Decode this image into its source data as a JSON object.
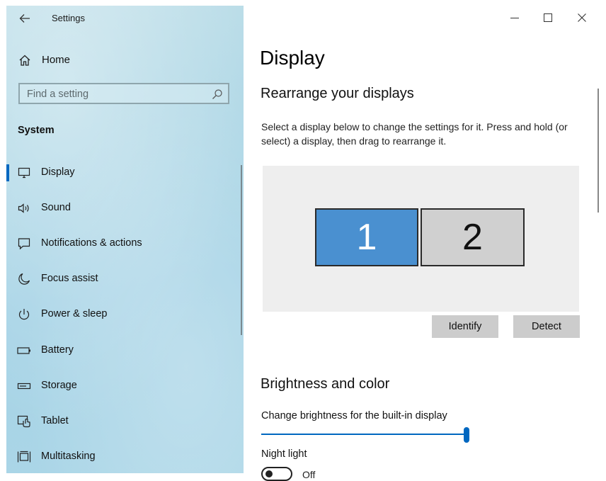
{
  "window": {
    "title": "Settings",
    "captions": {
      "minimize": "minimize-icon",
      "maximize": "maximize-icon",
      "close": "close-icon"
    }
  },
  "sidebar": {
    "home_label": "Home",
    "search_placeholder": "Find a setting",
    "section_title": "System",
    "items": [
      {
        "label": "Display",
        "icon": "monitor-icon",
        "selected": true
      },
      {
        "label": "Sound",
        "icon": "speaker-icon"
      },
      {
        "label": "Notifications & actions",
        "icon": "notification-icon"
      },
      {
        "label": "Focus assist",
        "icon": "moon-icon"
      },
      {
        "label": "Power & sleep",
        "icon": "power-icon"
      },
      {
        "label": "Battery",
        "icon": "battery-icon"
      },
      {
        "label": "Storage",
        "icon": "storage-icon"
      },
      {
        "label": "Tablet",
        "icon": "tablet-icon"
      },
      {
        "label": "Multitasking",
        "icon": "multitasking-icon"
      }
    ]
  },
  "main": {
    "title": "Display",
    "rearrange": {
      "heading": "Rearrange your displays",
      "description": "Select a display below to change the settings for it. Press and hold (or select) a display, then drag to rearrange it.",
      "monitors": [
        {
          "label": "1",
          "selected": true
        },
        {
          "label": "2",
          "selected": false
        }
      ],
      "identify_label": "Identify",
      "detect_label": "Detect"
    },
    "brightness": {
      "heading": "Brightness and color",
      "slider_label": "Change brightness for the built-in display",
      "slider_value": 1.0,
      "night_light_label": "Night light",
      "night_light_state": "Off"
    }
  },
  "colors": {
    "accent": "#0067c0",
    "monitor_selected": "#4a90d0",
    "monitor_unselected": "#d0d0d0",
    "button_bg": "#cccccc",
    "arrange_bg": "#eeeeee"
  }
}
